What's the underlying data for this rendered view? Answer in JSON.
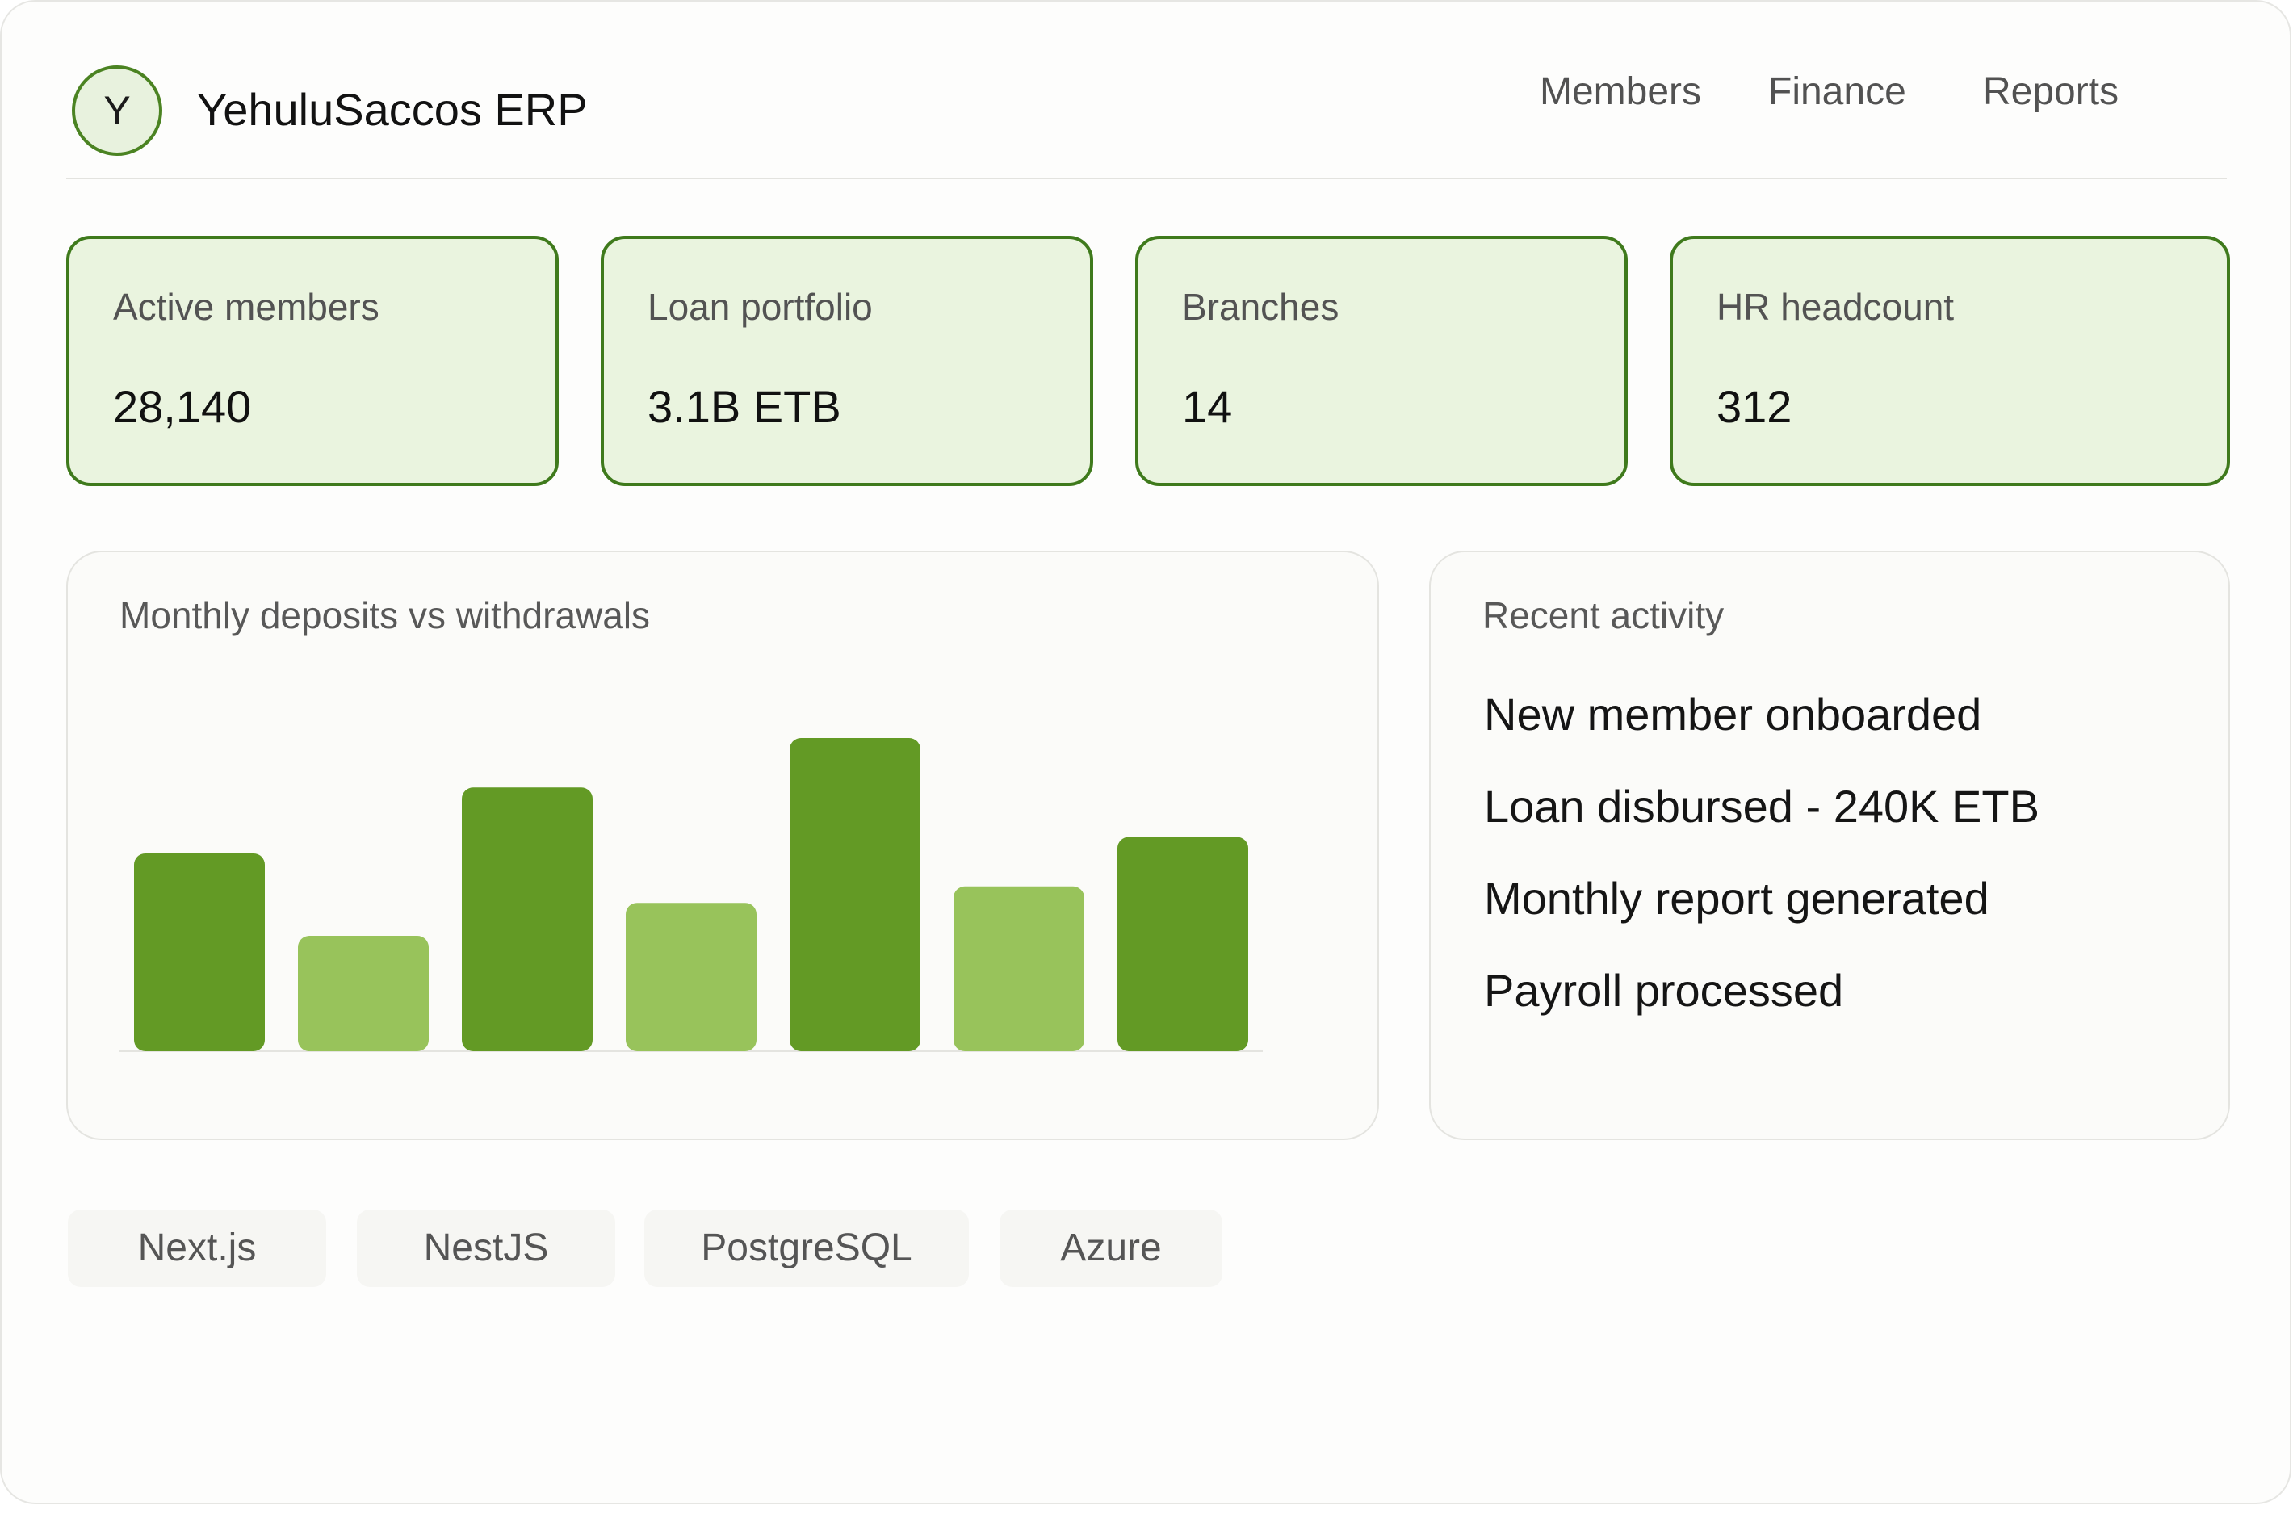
{
  "app": {
    "logo_letter": "Y",
    "title": "YehuluSaccos ERP"
  },
  "nav": {
    "items": [
      {
        "label": "Members"
      },
      {
        "label": "Finance"
      },
      {
        "label": "Reports"
      }
    ]
  },
  "stats": [
    {
      "label": "Active members",
      "value": "28,140"
    },
    {
      "label": "Loan portfolio",
      "value": "3.1B ETB"
    },
    {
      "label": "Branches",
      "value": "14"
    },
    {
      "label": "HR headcount",
      "value": "312"
    }
  ],
  "chart_panel": {
    "title": "Monthly deposits vs withdrawals"
  },
  "chart_data": {
    "type": "bar",
    "categories": [
      "",
      "",
      "",
      "",
      "",
      "",
      ""
    ],
    "values": [
      24,
      14,
      32,
      18,
      38,
      20,
      26
    ],
    "series_colors": [
      "#639a25",
      "#98c35b",
      "#639a25",
      "#98c35b",
      "#639a25",
      "#98c35b",
      "#639a25"
    ],
    "title": "Monthly deposits vs withdrawals",
    "xlabel": "",
    "ylabel": "",
    "ylim": [
      0,
      38
    ],
    "grid": false,
    "legend": "none"
  },
  "activity": {
    "title": "Recent activity",
    "items": [
      "New member onboarded",
      "Loan disbursed - 240K ETB",
      "Monthly report generated",
      "Payroll processed"
    ]
  },
  "tech_stack": [
    "Next.js",
    "NestJS",
    "PostgreSQL",
    "Azure"
  ],
  "colors": {
    "accent": "#639a25",
    "accent_light": "#98c35b",
    "card_border": "#3f7a1c",
    "card_fill": "#eaf4df"
  }
}
